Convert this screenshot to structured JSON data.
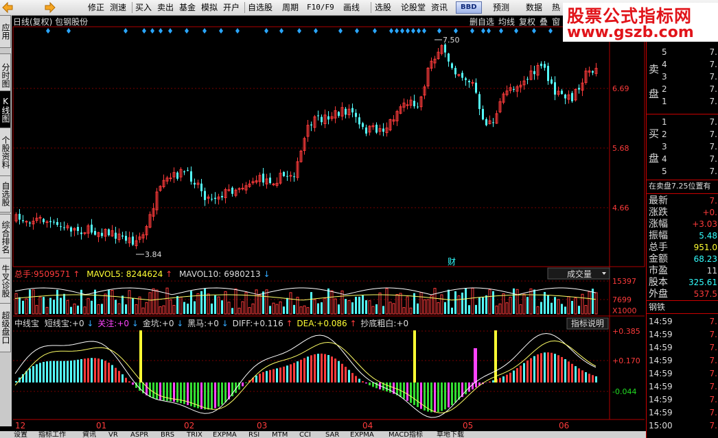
{
  "toolbar": {
    "items": [
      "修正",
      "测速",
      "买入",
      "卖出",
      "基金",
      "模拟",
      "开户",
      "自选股",
      "周期",
      "F10/F9",
      "画线",
      "选股",
      "论股堂",
      "资讯",
      "预测",
      "数据",
      "热"
    ],
    "bbd": "BBD"
  },
  "watermark": {
    "title": "股票公式指标网",
    "url": "www.gszb.com"
  },
  "left_tabs": [
    {
      "label": "应用"
    },
    {
      "label": "分时图"
    },
    {
      "label": "K线图",
      "active": true
    },
    {
      "label": "个股资料"
    },
    {
      "label": "自选股"
    },
    {
      "label": "综合排名"
    },
    {
      "label": "牛叉诊股"
    },
    {
      "label": "超级盘口"
    }
  ],
  "main_chart": {
    "title": "日线(复权) 包钢股份",
    "tabs": [
      "删自选",
      "均线",
      "复权",
      "叠",
      "窗"
    ],
    "price_ticks": [
      "6.69",
      "5.68",
      "4.66"
    ],
    "high_label": "7.50",
    "low_label": "3.84",
    "fin_marker": "财"
  },
  "volume_panel": {
    "total_label": "总手:",
    "total_value": "9509571",
    "mavol5_label": "MAVOL5:",
    "mavol5_value": "8244624",
    "mavol10_label": "MAVOL10:",
    "mavol10_value": "6980213",
    "dropdown": "成交量",
    "ticks": [
      "15397",
      "7699",
      "X1000"
    ]
  },
  "indicator_panel": {
    "name": "中线宝",
    "items": [
      {
        "label": "短线宝:",
        "value": "+0",
        "color": "#ffffff"
      },
      {
        "label": "关注:",
        "value": "+0",
        "color": "#ff44ff"
      },
      {
        "label": "金坑:",
        "value": "+0",
        "color": "#ffffff"
      },
      {
        "label": "黑马:",
        "value": "+0",
        "color": "#ffffff"
      },
      {
        "label": "DIFF:",
        "value": "+0.116",
        "color": "#ffffff"
      },
      {
        "label": "DEA:",
        "value": "+0.086",
        "color": "#ffff44"
      },
      {
        "label": "抄底粗白:",
        "value": "+0",
        "color": "#ffffff"
      }
    ],
    "button": "指标说明",
    "ticks": [
      "+0.385",
      "+0.170",
      "-0.044"
    ]
  },
  "x_axis": [
    "12",
    "01",
    "02",
    "03",
    "04",
    "05",
    "06"
  ],
  "orderbook": {
    "sell_label": [
      "卖",
      "盘"
    ],
    "buy_label": [
      "买",
      "盘"
    ],
    "sell_levels": [
      {
        "n": "5",
        "p": "7."
      },
      {
        "n": "4",
        "p": "7."
      },
      {
        "n": "3",
        "p": "7."
      },
      {
        "n": "2",
        "p": "7."
      },
      {
        "n": "1",
        "p": "7."
      }
    ],
    "buy_levels": [
      {
        "n": "1",
        "p": "7."
      },
      {
        "n": "2",
        "p": "7."
      },
      {
        "n": "3",
        "p": "7."
      },
      {
        "n": "4",
        "p": "7."
      },
      {
        "n": "5",
        "p": "7."
      }
    ],
    "position_note": "在卖盘7.25位置有"
  },
  "quote": [
    {
      "label": "最新",
      "value": "7."
    },
    {
      "label": "涨跌",
      "value": "+0."
    },
    {
      "label": "涨幅",
      "value": "+3.03"
    },
    {
      "label": "振幅",
      "value": "5.48"
    },
    {
      "label": "总手",
      "value": "951.0"
    },
    {
      "label": "金额",
      "value": "68.23"
    },
    {
      "label": "市盈",
      "value": "11"
    },
    {
      "label": "股本",
      "value": "325.61"
    },
    {
      "label": "外盘",
      "value": "537.5"
    }
  ],
  "trade_section": "钢铁",
  "trades": [
    {
      "time": "14:59",
      "price": "7."
    },
    {
      "time": "14:59",
      "price": "7."
    },
    {
      "time": "14:59",
      "price": "7."
    },
    {
      "time": "14:59",
      "price": "7."
    },
    {
      "time": "14:59",
      "price": "7."
    },
    {
      "time": "14:59",
      "price": "7."
    },
    {
      "time": "14:59",
      "price": "7."
    },
    {
      "time": "14:59",
      "price": "7."
    },
    {
      "time": "15:00",
      "price": "7."
    }
  ],
  "bottom_tabs": [
    "设置",
    "指标工作",
    "資讯",
    "VR",
    "ASPR",
    "BRS",
    "TRIX",
    "EXPMA",
    "RSI",
    "MTM",
    "CCI",
    "SAR",
    "EXPMA",
    "MACD指标",
    "草地下载"
  ]
}
